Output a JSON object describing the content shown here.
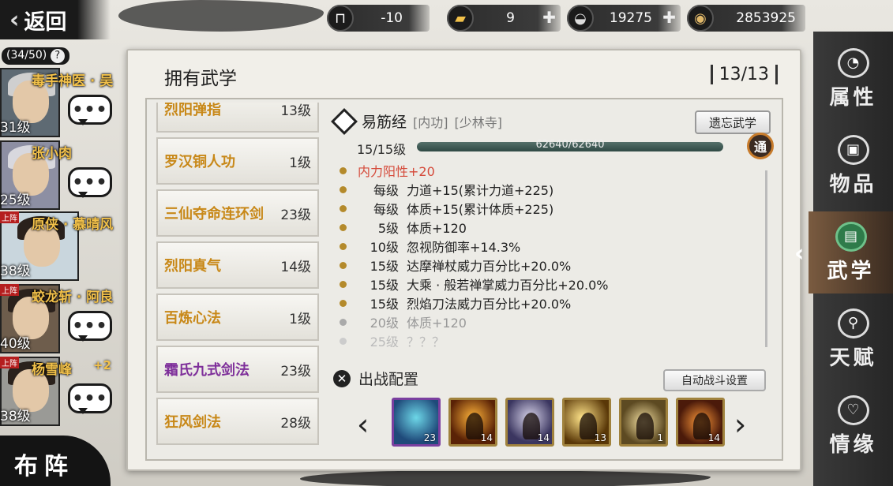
{
  "back": {
    "label": "返回"
  },
  "resources": [
    {
      "icon": "table-icon",
      "value": "-10",
      "has_plus": false
    },
    {
      "icon": "gold-bar-icon",
      "value": "9",
      "has_plus": true
    },
    {
      "icon": "silver-ingot-icon",
      "value": "19275",
      "has_plus": true
    },
    {
      "icon": "copper-coin-icon",
      "value": "2853925",
      "has_plus": false
    }
  ],
  "roster": {
    "capacity": "(34/50)",
    "help": "?",
    "heroes": [
      {
        "name": "毒手神医 · 吴",
        "level": "31级",
        "tag": "",
        "extra": ""
      },
      {
        "name": "张小肉",
        "level": "25级",
        "tag": "",
        "extra": ""
      },
      {
        "name": "原侠 · 慕晴风",
        "level": "38级",
        "tag": "上阵",
        "extra": ""
      },
      {
        "name": "蛟龙斩 · 阿良",
        "level": "40级",
        "tag": "上阵",
        "extra": ""
      },
      {
        "name": "杨雪峰",
        "level": "38级",
        "tag": "上阵",
        "extra": "+2"
      }
    ],
    "chat_glyph": "•••",
    "formation_label": "布阵"
  },
  "panel": {
    "title": "拥有武学",
    "count": "13/13",
    "skills": [
      {
        "name": "烈阳弹指",
        "level": "13级",
        "color": "#c88818"
      },
      {
        "name": "罗汉铜人功",
        "level": "1级",
        "color": "#c88818"
      },
      {
        "name": "三仙夺命连环剑",
        "level": "23级",
        "color": "#c88818"
      },
      {
        "name": "烈阳真气",
        "level": "14级",
        "color": "#c88818"
      },
      {
        "name": "百炼心法",
        "level": "1级",
        "color": "#c88818"
      },
      {
        "name": "霜氏九式剑法",
        "level": "23级",
        "color": "#7e2f9a"
      },
      {
        "name": "狂风剑法",
        "level": "28级",
        "color": "#c88818"
      }
    ],
    "detail": {
      "name": "易筋经",
      "type": "[内功]",
      "sect": "[少林寺]",
      "forget_label": "遗忘武学",
      "level_text": "15/15级",
      "progress_text": "62640/62640",
      "progress_fraction": 1.0,
      "badge": "通",
      "attributes": [
        {
          "level": "",
          "text": "内力阳性+20",
          "style": "red"
        },
        {
          "level": "每级",
          "text": "力道+15(累计力道+225)",
          "style": "normal"
        },
        {
          "level": "每级",
          "text": "体质+15(累计体质+225)",
          "style": "normal"
        },
        {
          "level": "5级",
          "text": "体质+120",
          "style": "normal"
        },
        {
          "level": "10级",
          "text": "忽视防御率+14.3%",
          "style": "normal"
        },
        {
          "level": "15级",
          "text": "达摩禅杖威力百分比+20.0%",
          "style": "normal"
        },
        {
          "level": "15级",
          "text": "大乘 · 般若禅掌威力百分比+20.0%",
          "style": "normal"
        },
        {
          "level": "15级",
          "text": "烈焰刀法威力百分比+20.0%",
          "style": "normal"
        },
        {
          "level": "20级",
          "text": "体质+120",
          "style": "grey"
        },
        {
          "level": "25级",
          "text": "？？？",
          "style": "faint"
        }
      ]
    },
    "battle": {
      "title": "出战配置",
      "auto_label": "自动战斗设置",
      "slots": [
        {
          "level": "23"
        },
        {
          "level": "14"
        },
        {
          "level": "14"
        },
        {
          "level": "13"
        },
        {
          "level": "1"
        },
        {
          "level": "14"
        }
      ]
    }
  },
  "tabs": [
    {
      "label": "属性",
      "icon": "mouse-icon",
      "active": false
    },
    {
      "label": "物品",
      "icon": "box-icon",
      "active": false
    },
    {
      "label": "武学",
      "icon": "book-icon",
      "active": true
    },
    {
      "label": "天赋",
      "icon": "talent-tree-icon",
      "active": false
    },
    {
      "label": "情缘",
      "icon": "heart-icon",
      "active": false
    }
  ]
}
